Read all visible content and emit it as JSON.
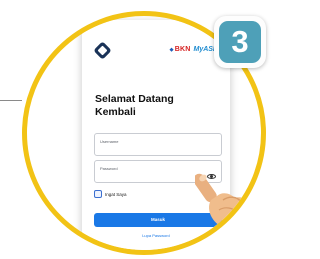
{
  "step_badge": {
    "number": "3",
    "color": "#4ea0b8"
  },
  "brand": {
    "bkn_label": "BKN",
    "myasn_label": "MyASN"
  },
  "login": {
    "title": "Selamat Datang Kembali",
    "username_placeholder": "Username",
    "password_placeholder": "Password",
    "remember_label": "Ingat Saya",
    "submit_label": "Masuk",
    "forgot_label": "Lupa Password"
  },
  "colors": {
    "ring": "#f2c315",
    "primary_button": "#1a78e6",
    "app_logo": "#1a3358"
  },
  "icons": [
    "app-logo-icon",
    "eye-icon",
    "checkbox-icon",
    "pointing-hand-icon"
  ]
}
